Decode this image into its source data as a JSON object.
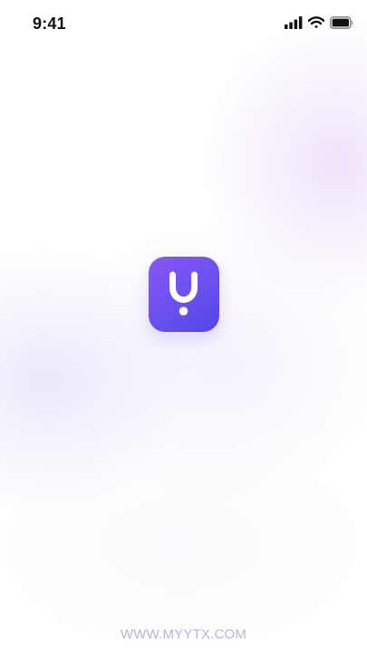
{
  "status_bar": {
    "time": "9:41"
  },
  "icons": {
    "signal": "cellular-signal-icon",
    "wifi": "wifi-icon",
    "battery": "battery-icon",
    "logo": "app-logo-icon"
  },
  "footer": {
    "url": "WWW.MYYTX.COM"
  },
  "colors": {
    "logo_gradient_start": "#8a56f6",
    "logo_gradient_end": "#5146e6",
    "footer_text": "#b6b4db"
  }
}
